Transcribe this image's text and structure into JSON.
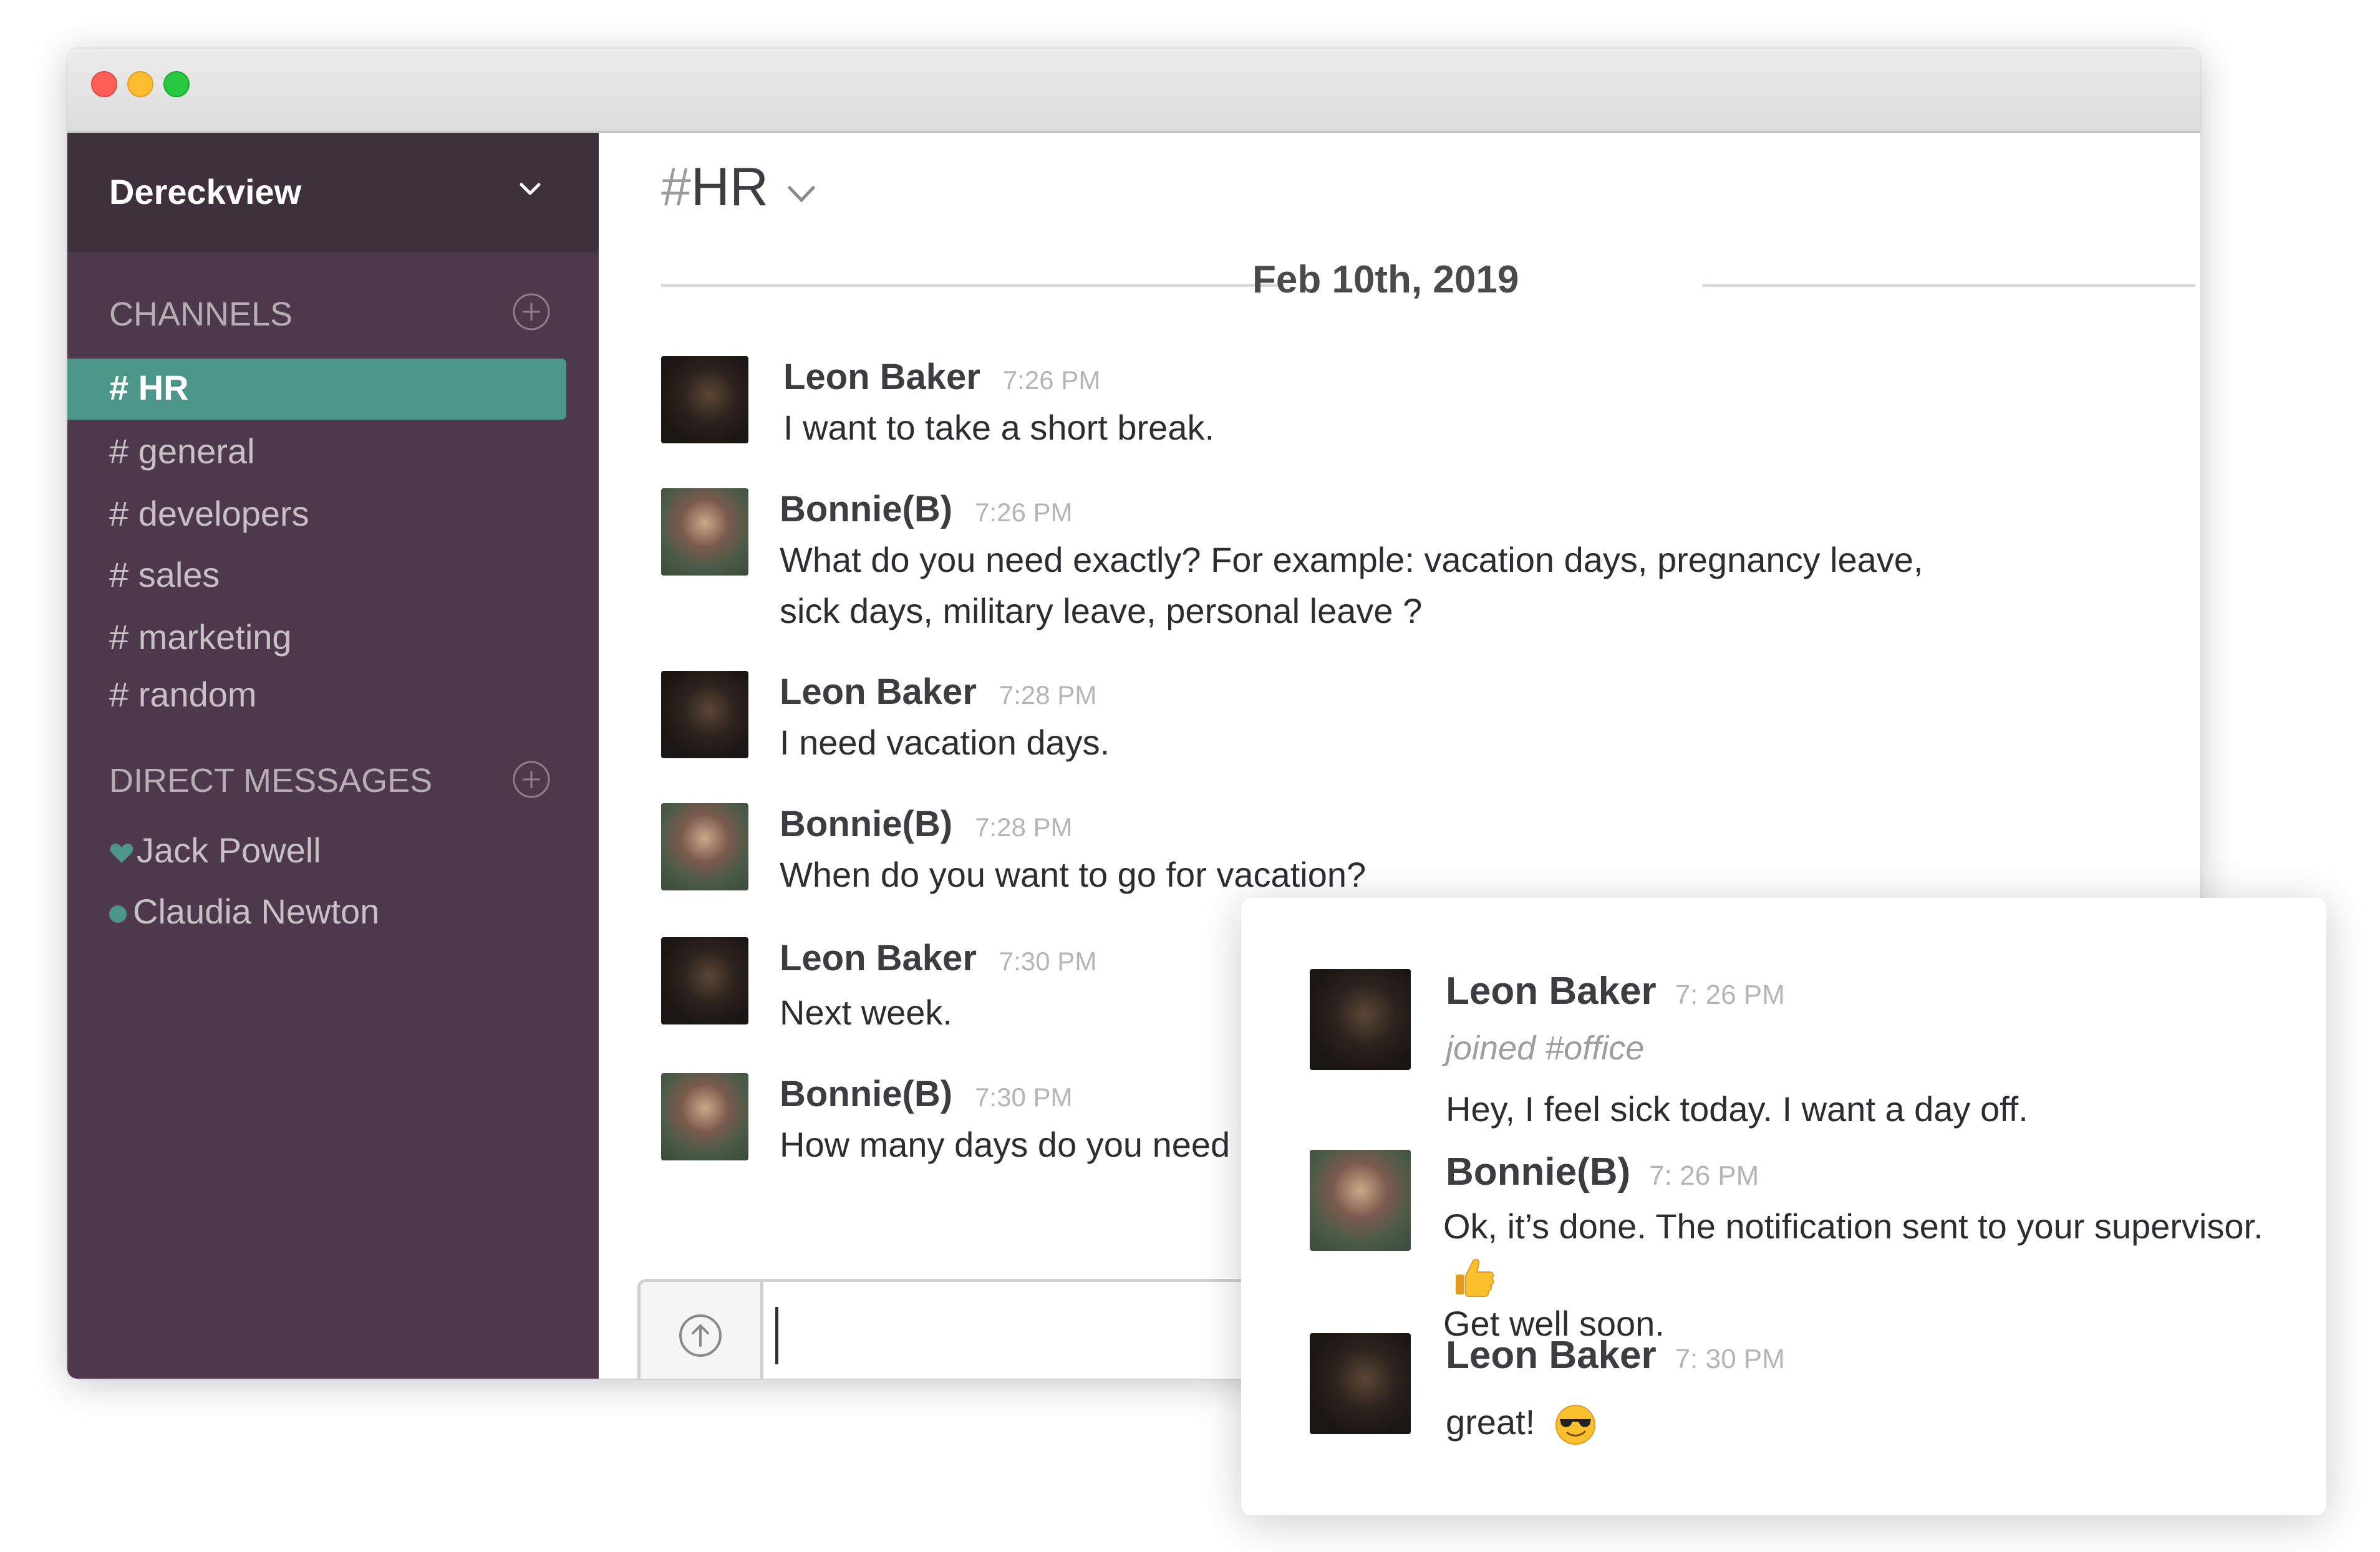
{
  "sidebar": {
    "team_name": "Dereckview",
    "channels_title": "CHANNELS",
    "channels": [
      {
        "label": "# HR",
        "active": true
      },
      {
        "label": "# general"
      },
      {
        "label": "# developers"
      },
      {
        "label": "# sales"
      },
      {
        "label": "# marketing"
      },
      {
        "label": "# random"
      }
    ],
    "dm_title": "DIRECT MESSAGES",
    "direct_messages": [
      {
        "label": "Jack Powell"
      },
      {
        "label": "Claudia Newton"
      }
    ]
  },
  "channel": {
    "hash": "#",
    "name": "HR",
    "date_divider": "Feb 10th, 2019"
  },
  "messages": [
    {
      "author": "Leon Baker",
      "time": "7:26 PM",
      "text": "I want to take a short break."
    },
    {
      "author": "Bonnie(B)",
      "time": "7:26 PM",
      "text": "What do you need exactly? For example: vacation days, pregnancy leave,\nsick days, military leave, personal leave ?"
    },
    {
      "author": "Leon Baker",
      "time": "7:28 PM",
      "text": "I need vacation days."
    },
    {
      "author": "Bonnie(B)",
      "time": "7:28 PM",
      "text": "When do you want to go for vacation?"
    },
    {
      "author": "Leon Baker",
      "time": "7:30 PM",
      "text": "Next week."
    },
    {
      "author": "Bonnie(B)",
      "time": "7:30 PM",
      "text": "How many days do you need"
    }
  ],
  "popup": {
    "messages": [
      {
        "author": "Leon Baker",
        "time": "7: 26 PM",
        "system": "joined #office",
        "text": "Hey, I feel sick today. I want a day off."
      },
      {
        "author": "Bonnie(B)",
        "time": "7: 26 PM",
        "text_line1": "Ok, it’s done. The notification sent to your supervisor.",
        "text_line2": "Get well soon."
      },
      {
        "author": "Leon Baker",
        "time": "7: 30 PM",
        "text": "great!"
      }
    ]
  },
  "colors": {
    "sidebar_bg": "#4d394b",
    "sidebar_header_bg": "#3e313c",
    "active_channel": "#4c9689",
    "presence": "#4c9689"
  },
  "icons": {
    "team_menu": "chevron-down-icon",
    "add": "plus-circle-icon",
    "upload": "arrow-up-circle-icon",
    "thumbs_up": "thumbs-up-emoji",
    "sunglasses": "sunglasses-emoji"
  }
}
